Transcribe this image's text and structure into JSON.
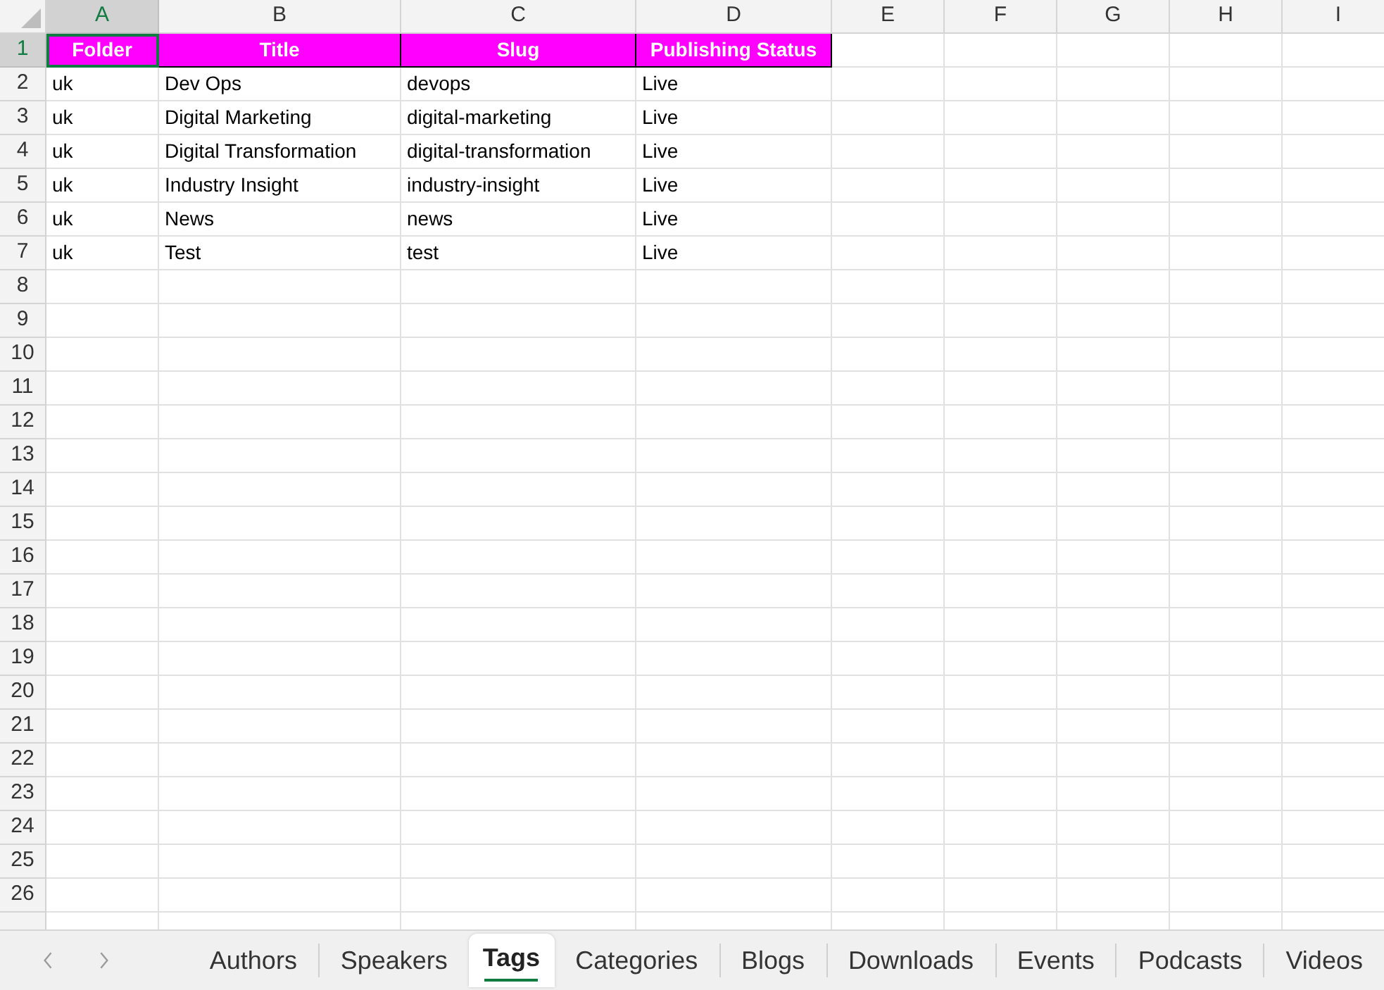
{
  "columns": [
    {
      "letter": "A",
      "selected": true
    },
    {
      "letter": "B",
      "selected": false
    },
    {
      "letter": "C",
      "selected": false
    },
    {
      "letter": "D",
      "selected": false
    },
    {
      "letter": "E",
      "selected": false
    },
    {
      "letter": "F",
      "selected": false
    },
    {
      "letter": "G",
      "selected": false
    },
    {
      "letter": "H",
      "selected": false
    },
    {
      "letter": "I",
      "selected": false
    }
  ],
  "rows": [
    {
      "number": "1",
      "kind": "header",
      "selected": true,
      "cells": [
        {
          "text": "Folder",
          "selected": true
        },
        {
          "text": "Title",
          "selected": false
        },
        {
          "text": "Slug",
          "selected": false
        },
        {
          "text": "Publishing Status",
          "selected": false
        }
      ]
    },
    {
      "number": "2",
      "kind": "data",
      "selected": false,
      "cells": [
        {
          "text": "uk",
          "selected": false
        },
        {
          "text": "Dev Ops",
          "selected": false
        },
        {
          "text": "devops",
          "selected": false
        },
        {
          "text": "Live",
          "selected": false
        }
      ]
    },
    {
      "number": "3",
      "kind": "data",
      "selected": false,
      "cells": [
        {
          "text": "uk",
          "selected": false
        },
        {
          "text": "Digital Marketing",
          "selected": false
        },
        {
          "text": "digital-marketing",
          "selected": false
        },
        {
          "text": "Live",
          "selected": false
        }
      ]
    },
    {
      "number": "4",
      "kind": "data",
      "selected": false,
      "cells": [
        {
          "text": "uk",
          "selected": false
        },
        {
          "text": "Digital Transformation",
          "selected": false
        },
        {
          "text": "digital-transformation",
          "selected": false
        },
        {
          "text": "Live",
          "selected": false
        }
      ]
    },
    {
      "number": "5",
      "kind": "data",
      "selected": false,
      "cells": [
        {
          "text": "uk",
          "selected": false
        },
        {
          "text": "Industry Insight",
          "selected": false
        },
        {
          "text": "industry-insight",
          "selected": false
        },
        {
          "text": "Live",
          "selected": false
        }
      ]
    },
    {
      "number": "6",
      "kind": "data",
      "selected": false,
      "cells": [
        {
          "text": "uk",
          "selected": false
        },
        {
          "text": "News",
          "selected": false
        },
        {
          "text": "news",
          "selected": false
        },
        {
          "text": "Live",
          "selected": false
        }
      ]
    },
    {
      "number": "7",
      "kind": "data",
      "selected": false,
      "cells": [
        {
          "text": "uk",
          "selected": false
        },
        {
          "text": "Test",
          "selected": false
        },
        {
          "text": "test",
          "selected": false
        },
        {
          "text": "Live",
          "selected": false
        }
      ]
    },
    {
      "number": "8",
      "kind": "data",
      "selected": false
    },
    {
      "number": "9",
      "kind": "data",
      "selected": false
    },
    {
      "number": "10",
      "kind": "data",
      "selected": false
    },
    {
      "number": "11",
      "kind": "data",
      "selected": false
    },
    {
      "number": "12",
      "kind": "data",
      "selected": false
    },
    {
      "number": "13",
      "kind": "data",
      "selected": false
    },
    {
      "number": "14",
      "kind": "data",
      "selected": false
    },
    {
      "number": "15",
      "kind": "data",
      "selected": false
    },
    {
      "number": "16",
      "kind": "data",
      "selected": false
    },
    {
      "number": "17",
      "kind": "data",
      "selected": false
    },
    {
      "number": "18",
      "kind": "data",
      "selected": false
    },
    {
      "number": "19",
      "kind": "data",
      "selected": false
    },
    {
      "number": "20",
      "kind": "data",
      "selected": false
    },
    {
      "number": "21",
      "kind": "data",
      "selected": false
    },
    {
      "number": "22",
      "kind": "data",
      "selected": false
    },
    {
      "number": "23",
      "kind": "data",
      "selected": false
    },
    {
      "number": "24",
      "kind": "data",
      "selected": false
    },
    {
      "number": "25",
      "kind": "data",
      "selected": false
    },
    {
      "number": "26",
      "kind": "data",
      "selected": false
    }
  ],
  "sheet_tabs": [
    {
      "label": "Authors",
      "selected": false
    },
    {
      "label": "Speakers",
      "selected": false
    },
    {
      "label": "Tags",
      "selected": true
    },
    {
      "label": "Categories",
      "selected": false
    },
    {
      "label": "Blogs",
      "selected": false
    },
    {
      "label": "Downloads",
      "selected": false
    },
    {
      "label": "Events",
      "selected": false
    },
    {
      "label": "Podcasts",
      "selected": false
    },
    {
      "label": "Videos",
      "selected": false
    }
  ]
}
